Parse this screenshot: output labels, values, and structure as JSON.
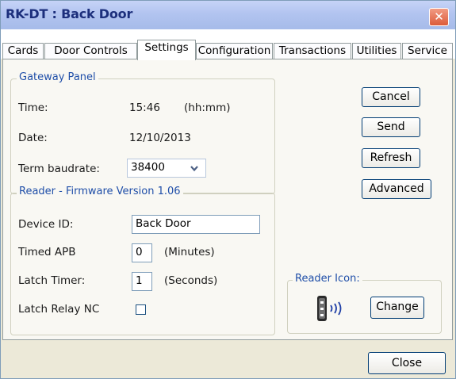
{
  "window": {
    "title": "RK-DT : Back Door",
    "close_glyph": "✕"
  },
  "tabs": [
    {
      "label": "Cards"
    },
    {
      "label": "Door Controls"
    },
    {
      "label": "Settings"
    },
    {
      "label": "Configuration"
    },
    {
      "label": "Transactions"
    },
    {
      "label": "Utilities"
    },
    {
      "label": "Service"
    }
  ],
  "active_tab": "Settings",
  "gateway": {
    "legend": "Gateway Panel",
    "time_label": "Time:",
    "time_value": "15:46",
    "time_unit": "(hh:mm)",
    "date_label": "Date:",
    "date_value": "12/10/2013",
    "baud_label": "Term baudrate:",
    "baud_value": "38400"
  },
  "reader": {
    "legend": "Reader - Firmware Version 1.06",
    "device_id_label": "Device ID:",
    "device_id_value": "Back Door",
    "timed_apb_label": "Timed  APB",
    "timed_apb_value": "0",
    "timed_apb_unit": "(Minutes)",
    "latch_timer_label": "Latch Timer:",
    "latch_timer_value": "1",
    "latch_timer_unit": "(Seconds)",
    "latch_relay_label": "Latch Relay NC",
    "latch_relay_checked": false
  },
  "actions": {
    "cancel": "Cancel",
    "send": "Send",
    "refresh": "Refresh",
    "advanced": "Advanced"
  },
  "reader_icon": {
    "legend": "Reader Icon:",
    "icon": "card-reader-icon",
    "change": "Change"
  },
  "footer": {
    "close": "Close"
  },
  "colors": {
    "group_label": "#1f4ea8",
    "title": "#1c2f7c",
    "button_border": "#003c74"
  }
}
